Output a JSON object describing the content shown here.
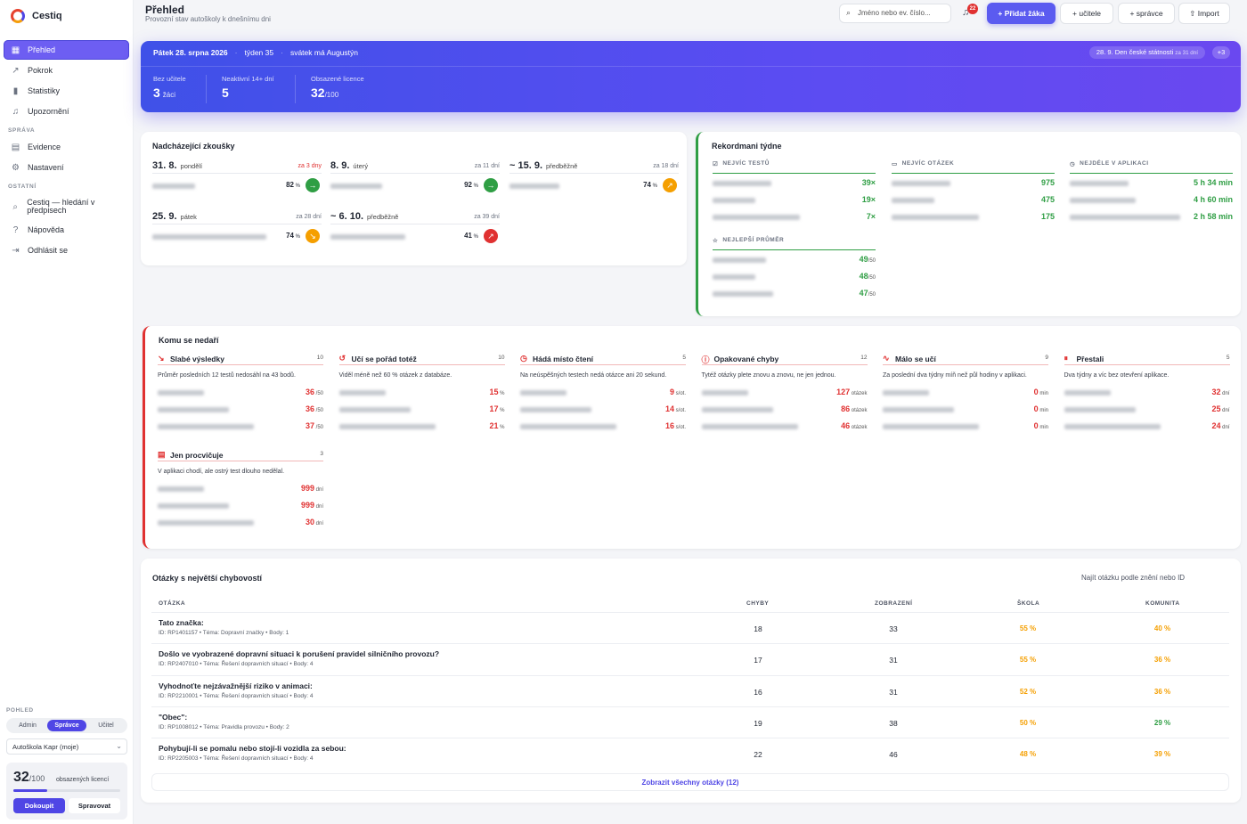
{
  "app": {
    "name": "Cestiq"
  },
  "sidebar": {
    "items": [
      {
        "label": "Přehled",
        "icon": "grid-icon",
        "glyph": "▦"
      },
      {
        "label": "Pokrok",
        "icon": "trend-icon",
        "glyph": "↗"
      },
      {
        "label": "Statistiky",
        "icon": "bar-chart-icon",
        "glyph": "▮"
      },
      {
        "label": "Upozornění",
        "icon": "bell-icon",
        "glyph": "♫"
      }
    ],
    "section_sprava": "SPRÁVA",
    "sprava_items": [
      {
        "label": "Evidence",
        "icon": "clipboard-icon",
        "glyph": "▤"
      },
      {
        "label": "Nastavení",
        "icon": "gear-icon",
        "glyph": "⚙"
      }
    ],
    "section_ostatni": "OSTATNÍ",
    "ostatni_items": [
      {
        "label": "Cestiq — hledání v předpisech",
        "icon": "search-icon",
        "glyph": "⌕"
      },
      {
        "label": "Nápověda",
        "icon": "help-icon",
        "glyph": "?"
      },
      {
        "label": "Odhlásit se",
        "icon": "logout-icon",
        "glyph": "⇥"
      }
    ],
    "view_label": "POHLED",
    "view_options": [
      "Admin",
      "Správce",
      "Učitel"
    ],
    "view_selected": "Správce",
    "school": "Autoškola Kapr (moje)",
    "licenses": {
      "used": "32",
      "total": "/100",
      "label": "obsazených licencí",
      "fraction": 0.32,
      "buy": "Dokoupit",
      "manage": "Spravovat"
    }
  },
  "header": {
    "title": "Přehled",
    "subtitle": "Provozní stav autoškoly k dnešnímu dni",
    "search_placeholder": "Jméno nebo ev. číslo...",
    "notifications": "22",
    "add_student": "Přidat žáka",
    "add_teacher": "učitele",
    "add_admin": "správce",
    "import": "Import"
  },
  "hero": {
    "date": "Pátek 28. srpna 2026",
    "week": "týden 35",
    "nameday": "svátek má Augustýn",
    "holiday": "28. 9. Den české státnosti",
    "holiday_in": "za 31 dní",
    "holiday_more": "+3",
    "kpis": [
      {
        "label": "Bez učitele",
        "value": "3",
        "unit": "žáci"
      },
      {
        "label": "Neaktivní 14+ dní",
        "value": "5",
        "unit": ""
      },
      {
        "label": "Obsazené licence",
        "value": "32",
        "unit": "/100"
      }
    ]
  },
  "exams": {
    "title": "Nadcházející zkoušky",
    "items": [
      {
        "date": "31. 8.",
        "day": "pondělí",
        "in": "za 3 dny",
        "urgent": true,
        "pct": "82",
        "trend": "up"
      },
      {
        "date": "8. 9.",
        "day": "úterý",
        "in": "za 11 dní",
        "urgent": false,
        "pct": "92",
        "trend": "up"
      },
      {
        "date": "~ 15. 9.",
        "day": "předběžně",
        "in": "za 18 dní",
        "urgent": false,
        "pct": "74",
        "trend": "warn-up"
      },
      {
        "date": "25. 9.",
        "day": "pátek",
        "in": "za 28 dní",
        "urgent": false,
        "pct": "74",
        "trend": "warn-down"
      },
      {
        "date": "~ 6. 10.",
        "day": "předběžně",
        "in": "za 39 dní",
        "urgent": false,
        "pct": "41",
        "trend": "down"
      }
    ]
  },
  "records": {
    "title": "Rekordmani týdne",
    "cols": [
      {
        "head": "NEJVÍC TESTŮ",
        "icon": "checkbox-icon",
        "glyph": "☑",
        "values": [
          "39×",
          "19×",
          "7×"
        ]
      },
      {
        "head": "NEJVÍC OTÁZEK",
        "icon": "document-icon",
        "glyph": "▭",
        "values": [
          "975",
          "475",
          "175"
        ]
      },
      {
        "head": "NEJDÉLE V APLIKACI",
        "icon": "clock-icon",
        "glyph": "◷",
        "values": [
          "5 h 34 min",
          "4 h 60 min",
          "2 h 58 min"
        ]
      }
    ],
    "best": {
      "head": "NEJLEPŠÍ PRŮMĚR",
      "icon": "star-icon",
      "glyph": "☆",
      "values": [
        "49",
        "48",
        "47"
      ],
      "unit": "/50"
    }
  },
  "struggling": {
    "title": "Komu se nedaří",
    "groups": [
      {
        "title": "Slabé výsledky",
        "icon": "trend-down-icon",
        "glyph": "↘",
        "count": "10",
        "desc": "Průměr posledních 12 testů nedosáhl na 43 bodů.",
        "values": [
          "36",
          "36",
          "37"
        ],
        "unit": "/50"
      },
      {
        "title": "Učí se pořád totéž",
        "icon": "refresh-icon",
        "glyph": "↺",
        "count": "10",
        "desc": "Viděl méně než 60 % otázek z databáze.",
        "values": [
          "15",
          "17",
          "21"
        ],
        "unit": "%"
      },
      {
        "title": "Hádá místo čtení",
        "icon": "timer-icon",
        "glyph": "◷",
        "count": "5",
        "desc": "Na neúspěšných testech nedá otázce ani 20 sekund.",
        "values": [
          "9",
          "14",
          "16"
        ],
        "unit": "s/ot."
      },
      {
        "title": "Opakované chyby",
        "icon": "alert-icon",
        "glyph": "ⓘ",
        "count": "12",
        "desc": "Tytéž otázky plete znovu a znovu, ne jen jednou.",
        "values": [
          "127",
          "86",
          "46"
        ],
        "unit": "otázek"
      },
      {
        "title": "Málo se učí",
        "icon": "pulse-icon",
        "glyph": "∿",
        "count": "9",
        "desc": "Za poslední dva týdny míň než půl hodiny v aplikaci.",
        "values": [
          "0",
          "0",
          "0"
        ],
        "unit": "min"
      },
      {
        "title": "Přestali",
        "icon": "pause-icon",
        "glyph": "⏸",
        "count": "5",
        "desc": "Dva týdny a víc bez otevření aplikace.",
        "values": [
          "32",
          "25",
          "24"
        ],
        "unit": "dní"
      },
      {
        "title": "Jen procvičuje",
        "icon": "clipboard-icon",
        "glyph": "▤",
        "count": "3",
        "desc": "V aplikaci chodí, ale ostrý test dlouho nedělal.",
        "values": [
          "999",
          "999",
          "30"
        ],
        "unit": "dní"
      }
    ]
  },
  "questions": {
    "title": "Otázky s největší chybovostí",
    "search_placeholder": "Najít otázku podle znění nebo ID",
    "headers": [
      "OTÁZKA",
      "CHYBY",
      "ZOBRAZENÍ",
      "ŠKOLA",
      "KOMUNITA"
    ],
    "rows": [
      {
        "q": "Tato značka:",
        "meta": "ID: RP1401157 • Téma: Dopravní značky • Body: 1",
        "errors": "18",
        "views": "33",
        "school": "55 %",
        "community": "40 %",
        "school_color": "#f59f00",
        "community_color": "#f59f00"
      },
      {
        "q": "Došlo ve vyobrazené dopravní situaci k porušení pravidel silničního provozu?",
        "meta": "ID: RP2407010 • Téma: Řešení dopravních situací • Body: 4",
        "errors": "17",
        "views": "31",
        "school": "55 %",
        "community": "36 %",
        "school_color": "#f59f00",
        "community_color": "#f59f00"
      },
      {
        "q": "Vyhodnoťte nejzávažnější riziko v animaci:",
        "meta": "ID: RP2210001 • Téma: Řešení dopravních situací • Body: 4",
        "errors": "16",
        "views": "31",
        "school": "52 %",
        "community": "36 %",
        "school_color": "#f59f00",
        "community_color": "#f59f00"
      },
      {
        "q": "\"Obec\":",
        "meta": "ID: RP1008012 • Téma: Pravidla provozu • Body: 2",
        "errors": "19",
        "views": "38",
        "school": "50 %",
        "community": "29 %",
        "school_color": "#f59f00",
        "community_color": "#2f9e44"
      },
      {
        "q": "Pohybují-li se pomalu nebo stojí-li vozidla za sebou:",
        "meta": "ID: RP2205003 • Téma: Řešení dopravních situací • Body: 4",
        "errors": "22",
        "views": "46",
        "school": "48 %",
        "community": "39 %",
        "school_color": "#f59f00",
        "community_color": "#f59f00"
      }
    ],
    "show_all": "Zobrazit všechny otázky (12)"
  }
}
